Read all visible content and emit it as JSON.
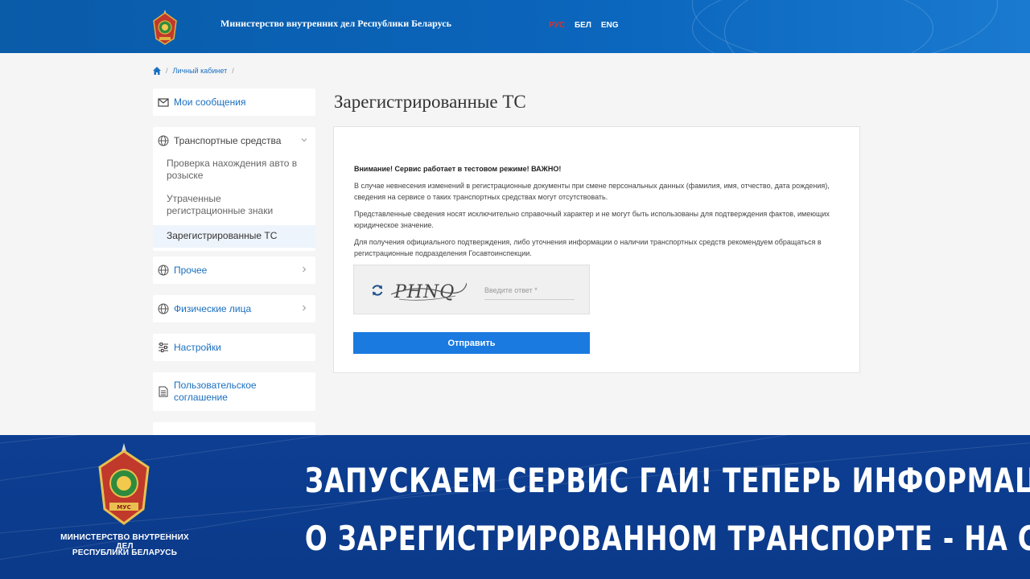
{
  "header": {
    "site_title": "Министерство внутренних дел Республики Беларусь",
    "languages": [
      "РУС",
      "БЕЛ",
      "ENG"
    ],
    "active_language": "РУС"
  },
  "breadcrumb": {
    "items": [
      "Личный кабинет"
    ]
  },
  "sidebar": {
    "messages": "Мои сообщения",
    "vehicles": "Транспортные средства",
    "vehicles_sub": [
      "Проверка нахождения авто в розыске",
      "Утраченные регистрационные знаки",
      "Зарегистрированные ТС"
    ],
    "other": "Прочее",
    "individuals": "Физические лица",
    "settings": "Настройки",
    "agreement": "Пользовательское соглашение"
  },
  "main": {
    "title": "Зарегистрированные ТС",
    "warning": "Внимание! Сервис работает в тестовом режиме! ВАЖНО!",
    "paragraphs": [
      "В случае невнесения изменений в регистрационные документы при смене персональных данных (фамилия, имя, отчество, дата рождения), сведения на сервисе о таких транспортных средствах могут отсутствовать.",
      "Представленные сведения носят исключительно справочный характер и не могут быть использованы для подтверждения фактов, имеющих юридическое значение.",
      "Для получения официального подтверждения, либо уточнения информации о наличии транспортных средств рекомендуем обращаться в регистрационные подразделения Госавтоинспекции."
    ],
    "captcha_text": "PHNQ",
    "captcha_placeholder": "Введите ответ *",
    "submit_label": "Отправить"
  },
  "banner": {
    "org_line1": "МИНИСТЕРСТВО ВНУТРЕННИХ ДЕЛ",
    "org_line2": "РЕСПУБЛИКИ БЕЛАРУСЬ",
    "emblem_text": "МУС",
    "headline_line1": "ЗАПУСКАЕМ СЕРВИС ГАИ! ТЕПЕРЬ ИНФОРМАЦИЯ",
    "headline_line2": "О ЗАРЕГИСТРИРОВАННОМ ТРАНСПОРТЕ - НА САЙТЕ МВД"
  },
  "colors": {
    "header_blue": "#0b66bd",
    "link_blue": "#1a6fc0",
    "button_blue": "#1a7ae0",
    "banner_blue": "#0d3e92",
    "active_lang_red": "#d9342b"
  }
}
